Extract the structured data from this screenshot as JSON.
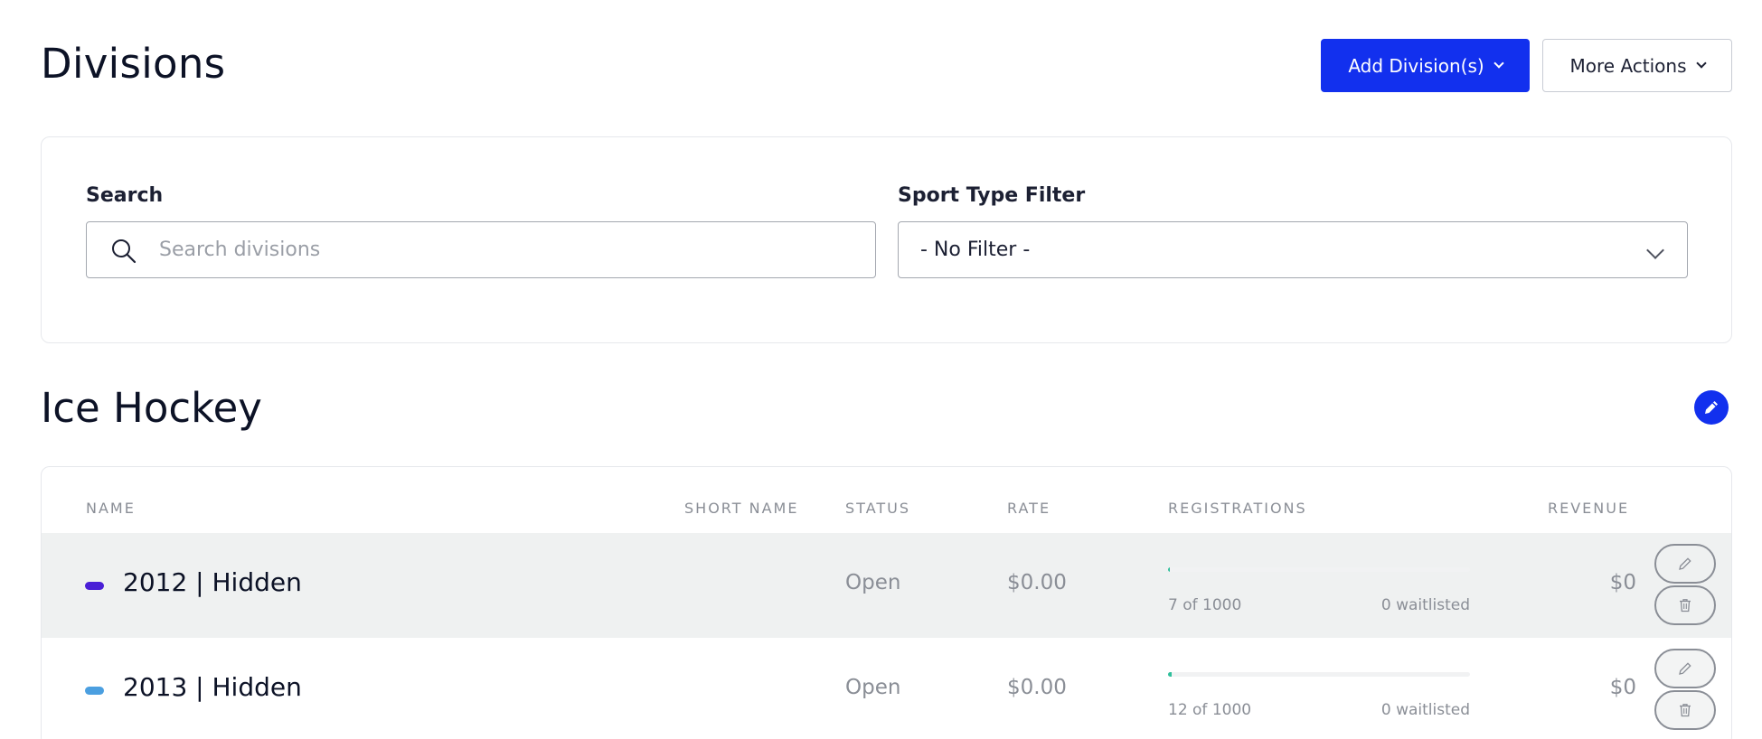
{
  "header": {
    "title": "Divisions",
    "add_button_label": "Add Division(s)",
    "more_actions_label": "More Actions"
  },
  "filters": {
    "search_label": "Search",
    "search_placeholder": "Search divisions",
    "search_value": "",
    "sport_filter_label": "Sport Type Filter",
    "sport_filter_value": "- No Filter -"
  },
  "section": {
    "title": "Ice Hockey",
    "edit_icon": "pencil-icon"
  },
  "table": {
    "columns": {
      "name": "NAME",
      "short_name": "SHORT NAME",
      "status": "STATUS",
      "rate": "RATE",
      "registrations": "REGISTRATIONS",
      "revenue": "REVENUE"
    },
    "rows": [
      {
        "name": "2012 | Hidden",
        "color": "#4a1fd6",
        "short_name": "",
        "status": "Open",
        "rate": "$0.00",
        "registrations_text": "7 of 1000",
        "registrations_count": 7,
        "registrations_capacity": 1000,
        "waitlisted": "0 waitlisted",
        "revenue": "$0"
      },
      {
        "name": "2013 | Hidden",
        "color": "#4b9fe0",
        "short_name": "",
        "status": "Open",
        "rate": "$0.00",
        "registrations_text": "12 of 1000",
        "registrations_count": 12,
        "registrations_capacity": 1000,
        "waitlisted": "0 waitlisted",
        "revenue": "$0"
      }
    ]
  },
  "colors": {
    "primary": "#1230ee",
    "progress": "#2fbf9b"
  }
}
